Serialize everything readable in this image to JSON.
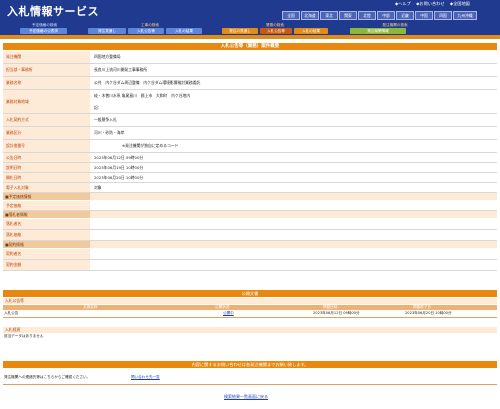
{
  "header": {
    "title": "入札情報サービス",
    "links": [
      "ヘルプ",
      "お問い合わせ",
      "全国地図"
    ],
    "regions": [
      "全国",
      "北海道",
      "東北",
      "関東",
      "北陸",
      "中部",
      "近畿",
      "中国",
      "四国",
      "九州沖縄"
    ]
  },
  "nav": {
    "groups": [
      "工事の検索",
      "業務の検索",
      "発注機関の検索"
    ],
    "prelabel": "予定価格の検索",
    "tabs": [
      "発注見通し",
      "発注の見通し",
      "入札公告等",
      "入札の結果",
      "発注の見通し",
      "入札公告等",
      "入札の結果",
      "発注機関情報"
    ],
    "lefttab": "予定価格の公表済"
  },
  "main": {
    "title": "入札公告等（業務）案件概要",
    "rows": [
      {
        "label": "発注機関",
        "value": "四国地方整備局"
      },
      {
        "label": "担当部・事務所",
        "value": "長良川上流河川開発工事事務所"
      },
      {
        "label": "業務名称",
        "value": "公共　内ケ谷ダム周辺整備　内ケ谷ダム環境影響検討業務委託"
      },
      {
        "label": "業務対象地域",
        "value": "岐・木曽川水系 亀尾島川　郡上市　大和町　内ケ谷地内"
      },
      {
        "label": "",
        "value": "記："
      },
      {
        "label": "入札契約方式",
        "value": "一般競争入札"
      },
      {
        "label": "業務区分",
        "value": "河川・砂防・海岸"
      },
      {
        "label": "設計書番号",
        "value": "※発注機関が独自に定めるコード"
      },
      {
        "label": "公告日時",
        "value": "2023年06月12日 09時00分"
      },
      {
        "label": "説明日時",
        "value": "2023年06月19日 10時00分"
      },
      {
        "label": "開札日時",
        "value": "2023年06月20日 10時00分"
      },
      {
        "label": "電子入札対象",
        "value": "対象"
      }
    ],
    "sections": [
      {
        "title": "■予定価格情報",
        "items": [
          "予定価格"
        ]
      },
      {
        "title": "■落札者情報",
        "items": [
          "落札者名",
          "落札価格"
        ]
      },
      {
        "title": "■契約情報",
        "items": [
          "契約者名",
          "契約金額"
        ]
      }
    ]
  },
  "public_docs": {
    "title": "公開文書",
    "sub1": "入札公告等",
    "columns": [
      "文書名称",
      "公開状況",
      "掲載日時",
      "掲載終了日"
    ],
    "row": {
      "name": "入札公告",
      "status": "公開中",
      "posted": "2023年06月12日 09時00分",
      "end": "2023年06月20日 10時00分"
    },
    "sub2": "入札経過",
    "empty": "該当データはありません"
  },
  "inquiry": {
    "title": "内容に関するお問い合わせは各発注機関までお願い致します。",
    "text": "発注機関への連絡先等はこちらからご確認ください。",
    "link": "問い合わせ先一覧"
  },
  "footer": {
    "back": "検索結果一覧画面に戻る"
  }
}
